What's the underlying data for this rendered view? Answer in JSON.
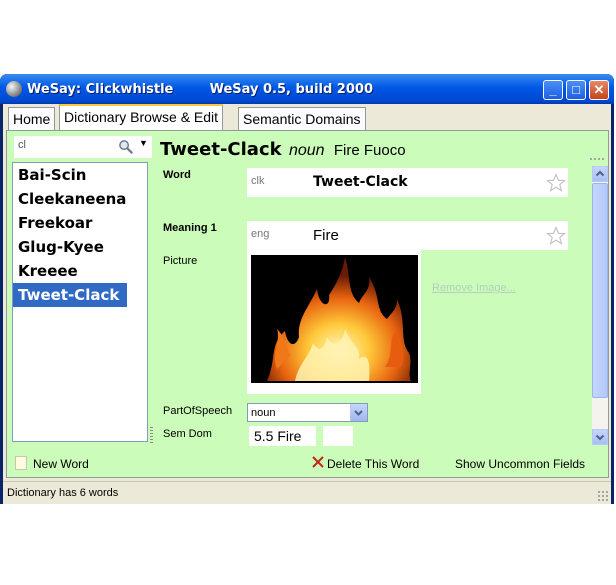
{
  "window": {
    "title": "WeSay: Clickwhistle        WeSay 0.5, build 2000",
    "buttons": {
      "minimize": "_",
      "maximize": "□",
      "close": "✕"
    }
  },
  "tabs": [
    {
      "label": "Home",
      "active": false
    },
    {
      "label": "Dictionary Browse & Edit",
      "active": true
    },
    {
      "label": "Semantic Domains",
      "active": false
    }
  ],
  "search": {
    "value": "cl",
    "icon": "search-icon"
  },
  "word_list": [
    "Bai-Scin",
    "Cleekaneena",
    "Freekoar",
    "Glug-Kyee",
    "Kreeee",
    "Tweet-Clack"
  ],
  "selected_word": "Tweet-Clack",
  "entry": {
    "headword": "Tweet-Clack",
    "pos": "noun",
    "gloss": "Fire Fuoco",
    "word_label": "Word",
    "word_ws": "clk",
    "word_value": "Tweet-Clack",
    "meaning_label": "Meaning 1",
    "meaning_ws": "eng",
    "meaning_value": "Fire",
    "picture_label": "Picture",
    "remove_image": "Remove Image...",
    "pos_label": "PartOfSpeech",
    "pos_value": "noun",
    "semdom_label": "Sem Dom",
    "semdom_value": "5.5 Fire"
  },
  "bottom": {
    "new_word": "New Word",
    "delete_word": "Delete This Word",
    "uncommon_fields": "Show Uncommon Fields"
  },
  "status": "Dictionary has 6 words",
  "colors": {
    "page_bg": "#cbfcb9",
    "selection": "#316ac5",
    "titlebar": "#0058e6"
  }
}
